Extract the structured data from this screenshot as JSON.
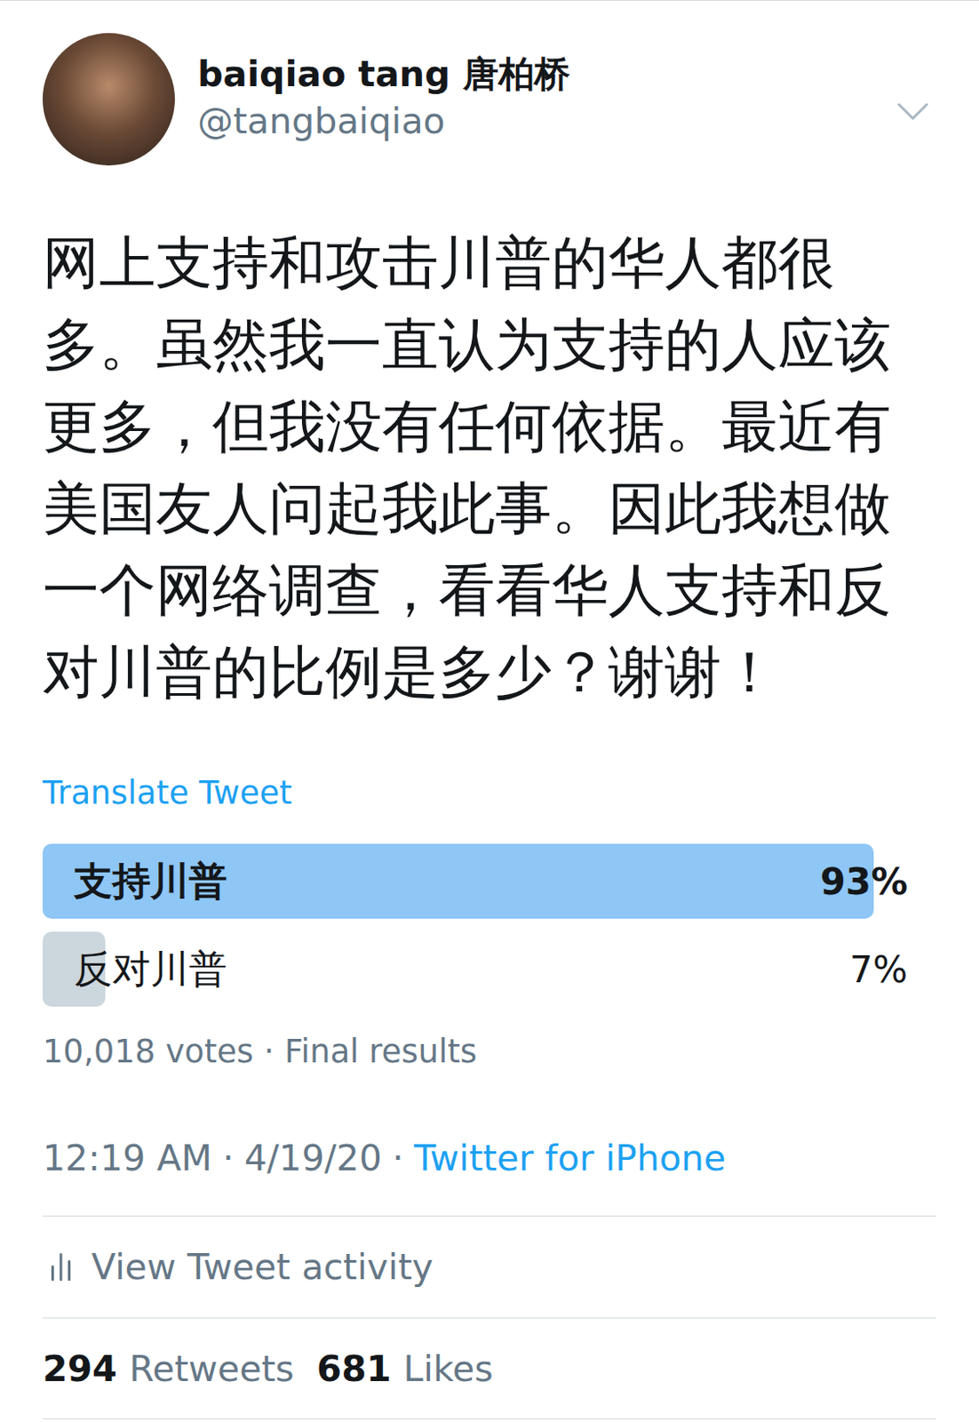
{
  "author": {
    "name": "baiqiao tang 唐柏桥",
    "handle": "@tangbaiqiao"
  },
  "tweet": {
    "text": "网上支持和攻击川普的华人都很多。虽然我一直认为支持的人应该更多，但我没有任何依据。最近有美国友人问起我此事。因此我想做一个网络调查，看看华人支持和反对川普的比例是多少？谢谢！"
  },
  "translate_link": "Translate Tweet",
  "poll": {
    "options": [
      {
        "label": "支持川普",
        "percent": "93%",
        "level": 0.93,
        "leading": true
      },
      {
        "label": "反对川普",
        "percent": "7%",
        "level": 0.07,
        "leading": false
      }
    ],
    "votes": "10,018 votes",
    "separator": "·",
    "status": "Final results"
  },
  "meta": {
    "time": "12:19 AM",
    "date": "4/19/20",
    "source": "Twitter for iPhone",
    "separator": "·"
  },
  "activity": {
    "label": "View Tweet activity"
  },
  "stats": [
    {
      "count": "294",
      "label": "Retweets"
    },
    {
      "count": "681",
      "label": "Likes"
    }
  ]
}
